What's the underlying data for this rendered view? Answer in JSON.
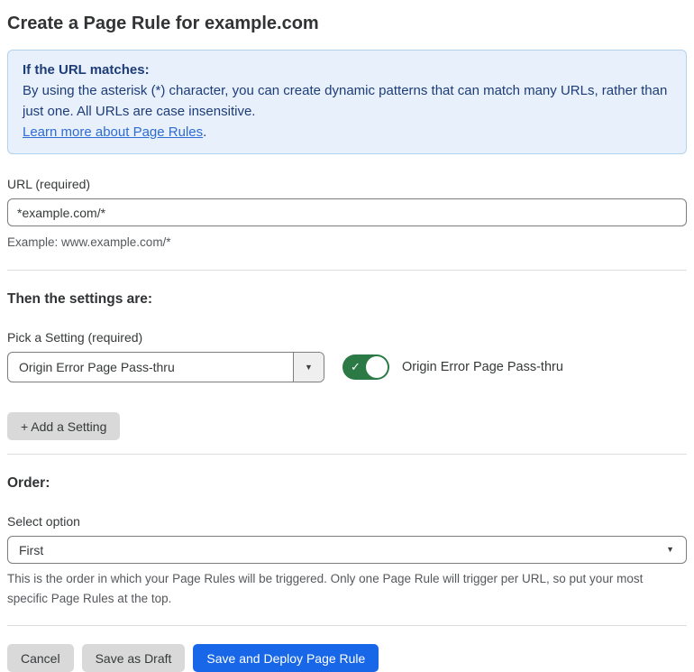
{
  "page": {
    "title": "Create a Page Rule for example.com"
  },
  "info_box": {
    "heading": "If the URL matches:",
    "body": "By using the asterisk (*) character, you can create dynamic patterns that can match many URLs, rather than just one. All URLs are case insensitive.",
    "link_label": "Learn more about Page Rules",
    "link_suffix": "."
  },
  "url_field": {
    "label": "URL (required)",
    "value": "*example.com/*",
    "helper": "Example: www.example.com/*"
  },
  "settings_section": {
    "heading": "Then the settings are:",
    "picker_label": "Pick a Setting (required)",
    "picker_value": "Origin Error Page Pass-thru",
    "toggle_state": "on",
    "toggle_check": "✓",
    "toggle_label": "Origin Error Page Pass-thru",
    "add_setting_label": "+ Add a Setting"
  },
  "order_section": {
    "heading": "Order:",
    "select_label": "Select option",
    "select_value": "First",
    "helper": "This is the order in which your Page Rules will be triggered. Only one Page Rule will trigger per URL, so put your most specific Page Rules at the top."
  },
  "footer": {
    "cancel_label": "Cancel",
    "save_draft_label": "Save as Draft",
    "save_deploy_label": "Save and Deploy Page Rule"
  },
  "icons": {
    "caret_down": "▼"
  },
  "colors": {
    "primary_button_blue": "#1767e8",
    "toggle_green": "#2b7a45",
    "info_box_bg": "#e8f1fb",
    "info_box_border": "#b3d2ee",
    "info_text_navy": "#1d3c78",
    "link_blue": "#2e6bd3",
    "gray_button_bg": "#d9d9d9",
    "divider_gray": "#dedede"
  }
}
